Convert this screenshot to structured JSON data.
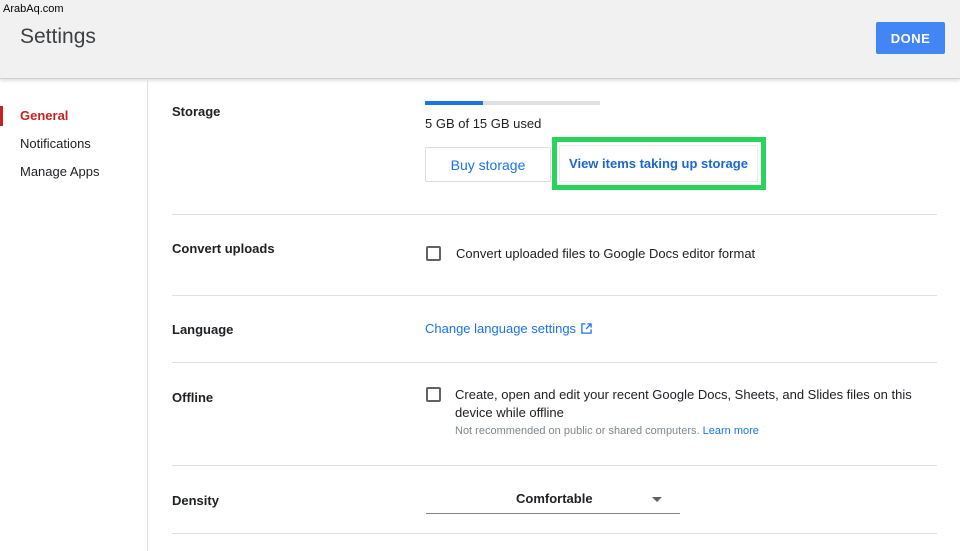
{
  "watermark": "ArabAq.com",
  "header": {
    "title": "Settings",
    "done_label": "DONE"
  },
  "sidebar": {
    "items": [
      {
        "label": "General",
        "active": true
      },
      {
        "label": "Notifications",
        "active": false
      },
      {
        "label": "Manage Apps",
        "active": false
      }
    ]
  },
  "sections": {
    "storage": {
      "label": "Storage",
      "used_gb": 5,
      "total_gb": 15,
      "used_fraction": 0.33,
      "usage_text": "5 GB of 15 GB used",
      "buy_label": "Buy storage",
      "view_label": "View items taking up storage"
    },
    "convert": {
      "label": "Convert uploads",
      "option_text": "Convert uploaded files to Google Docs editor format",
      "checked": false
    },
    "language": {
      "label": "Language",
      "link_text": "Change language settings"
    },
    "offline": {
      "label": "Offline",
      "option_line1": "Create, open and edit your recent Google Docs, Sheets, and Slides files on this",
      "option_line2": "device while offline",
      "hint": "Not recommended on public or shared computers.",
      "learn_more": "Learn more",
      "checked": false
    },
    "density": {
      "label": "Density",
      "selected": "Comfortable"
    }
  },
  "colors": {
    "accent_red": "#c5221f",
    "primary_blue": "#4285f4",
    "link_blue": "#1a73e8",
    "highlight_green": "#28d459"
  }
}
